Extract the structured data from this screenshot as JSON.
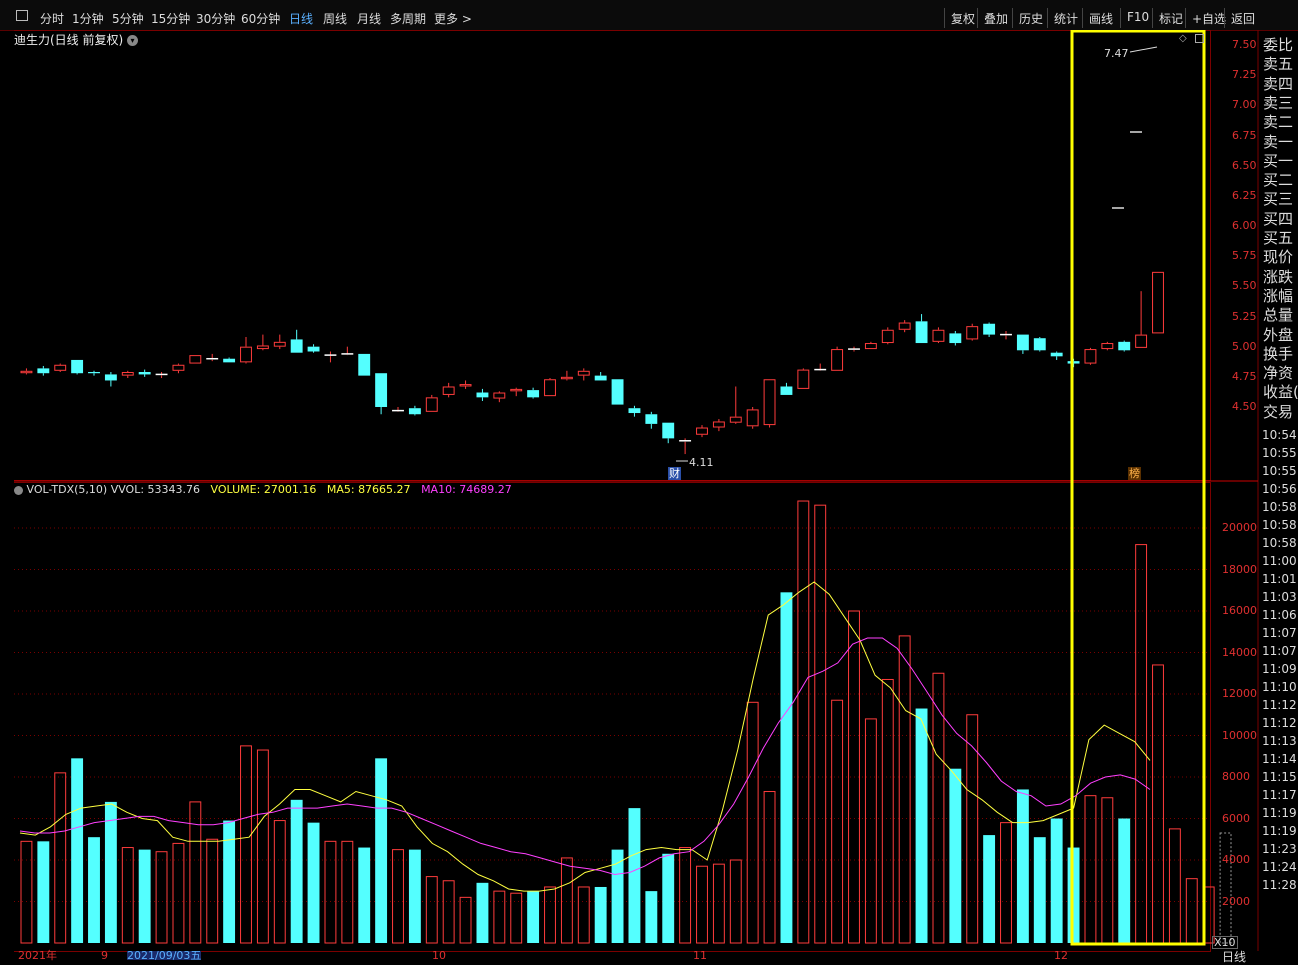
{
  "toolbar": {
    "periods": [
      "分时",
      "1分钟",
      "5分钟",
      "15分钟",
      "30分钟",
      "60分钟",
      "日线",
      "周线",
      "月线",
      "多周期",
      "更多 >"
    ],
    "active_period": "日线",
    "actions": [
      "复权",
      "叠加",
      "历史",
      "统计",
      "画线",
      "F10",
      "标记",
      "+自选",
      "返回"
    ]
  },
  "chart": {
    "title": "迪生力(日线 前复权)",
    "price_axis": [
      "7.50",
      "7.25",
      "7.00",
      "6.75",
      "6.50",
      "6.25",
      "6.00",
      "5.75",
      "5.50",
      "5.25",
      "5.00",
      "4.75",
      "4.50"
    ],
    "high_marker": "7.47",
    "low_marker": "4.11",
    "badge_cai": "财",
    "badge_bang": "榜"
  },
  "volume": {
    "legend_name": "VOL-TDX(5,10)",
    "vvol_label": "VVOL:",
    "vvol_value": "53343.76",
    "volume_label": "VOLUME:",
    "volume_value": "27001.16",
    "ma5_label": "MA5:",
    "ma5_value": "87665.27",
    "ma10_label": "MA10:",
    "ma10_value": "74689.27",
    "axis": [
      "20000",
      "18000",
      "16000",
      "14000",
      "12000",
      "10000",
      "8000",
      "6000",
      "4000",
      "2000"
    ],
    "multiplier": "X10"
  },
  "side_panel": {
    "labels": [
      "委比",
      "卖五",
      "卖四",
      "卖三",
      "卖二",
      "卖一",
      "买一",
      "买二",
      "买三",
      "买四",
      "买五",
      "现价",
      "涨跌",
      "涨幅",
      "总量",
      "外盘",
      "换手",
      "净资",
      "收益(",
      "交易"
    ],
    "times": [
      "10:54",
      "10:55",
      "10:55",
      "10:56",
      "10:58",
      "10:58",
      "10:58",
      "11:00",
      "11:01",
      "11:03",
      "11:06",
      "11:07",
      "11:07",
      "11:09",
      "11:10",
      "11:12",
      "11:12",
      "11:13",
      "11:14",
      "11:15",
      "11:17",
      "11:19",
      "11:19",
      "11:23",
      "11:24",
      "11:28"
    ],
    "bottom_label": "日线"
  },
  "bottom_axis": [
    "2021年",
    "9",
    "2021/09/03五",
    "10",
    "11",
    "12"
  ],
  "colors": {
    "up": "#ff3c3c",
    "down": "#54ffff",
    "ma5": "#ffff40",
    "ma10": "#ff40ff",
    "grid": "#7a0000",
    "highlight": "#ffff00"
  },
  "chart_data": {
    "type": "candlestick",
    "price_range": [
      4.25,
      7.55
    ],
    "volume_range": [
      0,
      21000
    ],
    "candles": [
      {
        "o": 4.78,
        "c": 4.8,
        "h": 4.82,
        "l": 4.77
      },
      {
        "o": 4.82,
        "c": 4.78,
        "h": 4.84,
        "l": 4.76
      },
      {
        "o": 4.8,
        "c": 4.85,
        "h": 4.86,
        "l": 4.79
      },
      {
        "o": 4.89,
        "c": 4.78,
        "h": 4.89,
        "l": 4.77
      },
      {
        "o": 4.79,
        "c": 4.78,
        "h": 4.8,
        "l": 4.76
      },
      {
        "o": 4.77,
        "c": 4.72,
        "h": 4.79,
        "l": 4.67
      },
      {
        "o": 4.76,
        "c": 4.79,
        "h": 4.8,
        "l": 4.74
      },
      {
        "o": 4.79,
        "c": 4.77,
        "h": 4.81,
        "l": 4.75
      },
      {
        "o": 4.77,
        "c": 4.77,
        "h": 4.79,
        "l": 4.74
      },
      {
        "o": 4.8,
        "c": 4.85,
        "h": 4.86,
        "l": 4.78
      },
      {
        "o": 4.86,
        "c": 4.93,
        "h": 4.93,
        "l": 4.86
      },
      {
        "o": 4.9,
        "c": 4.9,
        "h": 4.94,
        "l": 4.88
      },
      {
        "o": 4.9,
        "c": 4.87,
        "h": 4.91,
        "l": 4.87
      },
      {
        "o": 4.87,
        "c": 5.0,
        "h": 5.08,
        "l": 4.86
      },
      {
        "o": 4.98,
        "c": 5.01,
        "h": 5.1,
        "l": 4.97
      },
      {
        "o": 5.0,
        "c": 5.04,
        "h": 5.1,
        "l": 4.98
      },
      {
        "o": 5.06,
        "c": 4.95,
        "h": 5.14,
        "l": 4.95
      },
      {
        "o": 5.0,
        "c": 4.96,
        "h": 5.02,
        "l": 4.95
      },
      {
        "o": 4.93,
        "c": 4.93,
        "h": 4.96,
        "l": 4.87
      },
      {
        "o": 4.94,
        "c": 4.94,
        "h": 5.0,
        "l": 4.93
      },
      {
        "o": 4.94,
        "c": 4.76,
        "h": 4.94,
        "l": 4.76
      },
      {
        "o": 4.78,
        "c": 4.5,
        "h": 4.78,
        "l": 4.44
      },
      {
        "o": 4.47,
        "c": 4.47,
        "h": 4.5,
        "l": 4.46
      },
      {
        "o": 4.49,
        "c": 4.44,
        "h": 4.51,
        "l": 4.43
      },
      {
        "o": 4.46,
        "c": 4.58,
        "h": 4.6,
        "l": 4.46
      },
      {
        "o": 4.6,
        "c": 4.67,
        "h": 4.7,
        "l": 4.58
      },
      {
        "o": 4.67,
        "c": 4.69,
        "h": 4.72,
        "l": 4.65
      },
      {
        "o": 4.62,
        "c": 4.58,
        "h": 4.65,
        "l": 4.55
      },
      {
        "o": 4.57,
        "c": 4.62,
        "h": 4.63,
        "l": 4.54
      },
      {
        "o": 4.63,
        "c": 4.65,
        "h": 4.66,
        "l": 4.59
      },
      {
        "o": 4.64,
        "c": 4.58,
        "h": 4.66,
        "l": 4.57
      },
      {
        "o": 4.59,
        "c": 4.73,
        "h": 4.74,
        "l": 4.59
      },
      {
        "o": 4.73,
        "c": 4.75,
        "h": 4.8,
        "l": 4.72
      },
      {
        "o": 4.76,
        "c": 4.8,
        "h": 4.82,
        "l": 4.72
      },
      {
        "o": 4.76,
        "c": 4.72,
        "h": 4.79,
        "l": 4.72
      },
      {
        "o": 4.73,
        "c": 4.52,
        "h": 4.73,
        "l": 4.52
      },
      {
        "o": 4.49,
        "c": 4.45,
        "h": 4.51,
        "l": 4.42
      },
      {
        "o": 4.44,
        "c": 4.36,
        "h": 4.46,
        "l": 4.32
      },
      {
        "o": 4.37,
        "c": 4.24,
        "h": 4.37,
        "l": 4.2
      },
      {
        "o": 4.22,
        "c": 4.22,
        "h": 4.24,
        "l": 4.11
      },
      {
        "o": 4.27,
        "c": 4.33,
        "h": 4.35,
        "l": 4.25
      },
      {
        "o": 4.33,
        "c": 4.38,
        "h": 4.4,
        "l": 4.3
      },
      {
        "o": 4.37,
        "c": 4.42,
        "h": 4.67,
        "l": 4.36
      },
      {
        "o": 4.34,
        "c": 4.48,
        "h": 4.5,
        "l": 4.32
      },
      {
        "o": 4.35,
        "c": 4.73,
        "h": 4.73,
        "l": 4.33
      },
      {
        "o": 4.67,
        "c": 4.6,
        "h": 4.7,
        "l": 4.6
      },
      {
        "o": 4.65,
        "c": 4.81,
        "h": 4.82,
        "l": 4.65
      },
      {
        "o": 4.81,
        "c": 4.81,
        "h": 4.86,
        "l": 4.8
      },
      {
        "o": 4.8,
        "c": 4.98,
        "h": 5.0,
        "l": 4.8
      },
      {
        "o": 4.98,
        "c": 4.98,
        "h": 5.0,
        "l": 4.96
      },
      {
        "o": 4.98,
        "c": 5.03,
        "h": 5.04,
        "l": 4.98
      },
      {
        "o": 5.03,
        "c": 5.14,
        "h": 5.16,
        "l": 5.02
      },
      {
        "o": 5.14,
        "c": 5.2,
        "h": 5.22,
        "l": 5.12
      },
      {
        "o": 5.21,
        "c": 5.03,
        "h": 5.27,
        "l": 5.03
      },
      {
        "o": 5.04,
        "c": 5.14,
        "h": 5.16,
        "l": 5.03
      },
      {
        "o": 5.11,
        "c": 5.03,
        "h": 5.13,
        "l": 5.01
      },
      {
        "o": 5.06,
        "c": 5.17,
        "h": 5.19,
        "l": 5.05
      },
      {
        "o": 5.19,
        "c": 5.1,
        "h": 5.2,
        "l": 5.08
      },
      {
        "o": 5.1,
        "c": 5.1,
        "h": 5.13,
        "l": 5.06
      },
      {
        "o": 5.1,
        "c": 4.97,
        "h": 5.1,
        "l": 4.94
      },
      {
        "o": 5.07,
        "c": 4.97,
        "h": 5.08,
        "l": 4.96
      },
      {
        "o": 4.95,
        "c": 4.92,
        "h": 4.96,
        "l": 4.89
      },
      {
        "o": 4.88,
        "c": 4.86,
        "h": 4.9,
        "l": 4.83
      },
      {
        "o": 4.86,
        "c": 4.98,
        "h": 4.99,
        "l": 4.85
      },
      {
        "o": 4.98,
        "c": 5.03,
        "h": 5.04,
        "l": 4.97
      },
      {
        "o": 5.04,
        "c": 4.97,
        "h": 5.05,
        "l": 4.96
      },
      {
        "o": 4.99,
        "c": 5.1,
        "h": 5.46,
        "l": 4.99
      },
      {
        "o": 5.11,
        "c": 5.62,
        "h": 5.62,
        "l": 5.11
      }
    ],
    "volumes": [
      4900,
      4900,
      8200,
      8900,
      5100,
      6800,
      4600,
      4500,
      4400,
      4800,
      6800,
      5000,
      5900,
      9500,
      9300,
      5900,
      6900,
      5800,
      4900,
      4900,
      4600,
      8900,
      4500,
      4500,
      3200,
      3000,
      2200,
      2900,
      2500,
      2400,
      2500,
      2700,
      4100,
      2700,
      2700,
      4500,
      6500,
      2500,
      4300,
      4600,
      3700,
      3800,
      4000,
      11600,
      7300,
      16900,
      21300,
      21100,
      11700,
      16000,
      10800,
      12700,
      14800,
      11300,
      13000,
      8400,
      11000,
      5200,
      5800,
      7400,
      5100,
      6000,
      4600,
      7100,
      7000,
      6000,
      19200,
      13400,
      5500,
      3100,
      2700,
      5300
    ],
    "ma5": [
      5300,
      5200,
      5600,
      6200,
      6500,
      6600,
      6700,
      6300,
      6000,
      5900,
      5100,
      4900,
      4900,
      4900,
      5000,
      5100,
      6100,
      6700,
      7400,
      7400,
      7100,
      6800,
      7300,
      7100,
      6900,
      6600,
      5600,
      4800,
      4400,
      3800,
      3300,
      3000,
      2600,
      2500,
      2500,
      2600,
      2900,
      3400,
      3600,
      3800,
      4200,
      4500,
      4600,
      4500,
      4500,
      4000,
      6400,
      9300,
      12700,
      15800,
      16300,
      16900,
      17400,
      16800,
      15700,
      14600,
      12900,
      12300,
      11200,
      10800,
      9100,
      8300,
      7400,
      6900,
      6300,
      5800,
      5800,
      5900,
      6200,
      6500,
      9800,
      10500,
      10100,
      9700,
      8800
    ],
    "ma10": [
      5400,
      5300,
      5300,
      5400,
      5600,
      5800,
      5900,
      6000,
      6100,
      6100,
      5900,
      5800,
      5700,
      5700,
      5800,
      6000,
      6200,
      6300,
      6500,
      6500,
      6500,
      6600,
      6700,
      6600,
      6500,
      6500,
      6300,
      6000,
      5700,
      5400,
      5100,
      4800,
      4600,
      4400,
      4300,
      4100,
      3900,
      3700,
      3600,
      3500,
      3300,
      3400,
      3700,
      4100,
      4300,
      4400,
      4900,
      5700,
      6700,
      8000,
      9400,
      10600,
      11600,
      12800,
      13100,
      13500,
      14400,
      14700,
      14700,
      14200,
      13200,
      12100,
      11000,
      10100,
      9500,
      8700,
      7800,
      7300,
      7100,
      6600,
      6700,
      7100,
      7700,
      8000,
      8100,
      7900,
      7400
    ]
  }
}
